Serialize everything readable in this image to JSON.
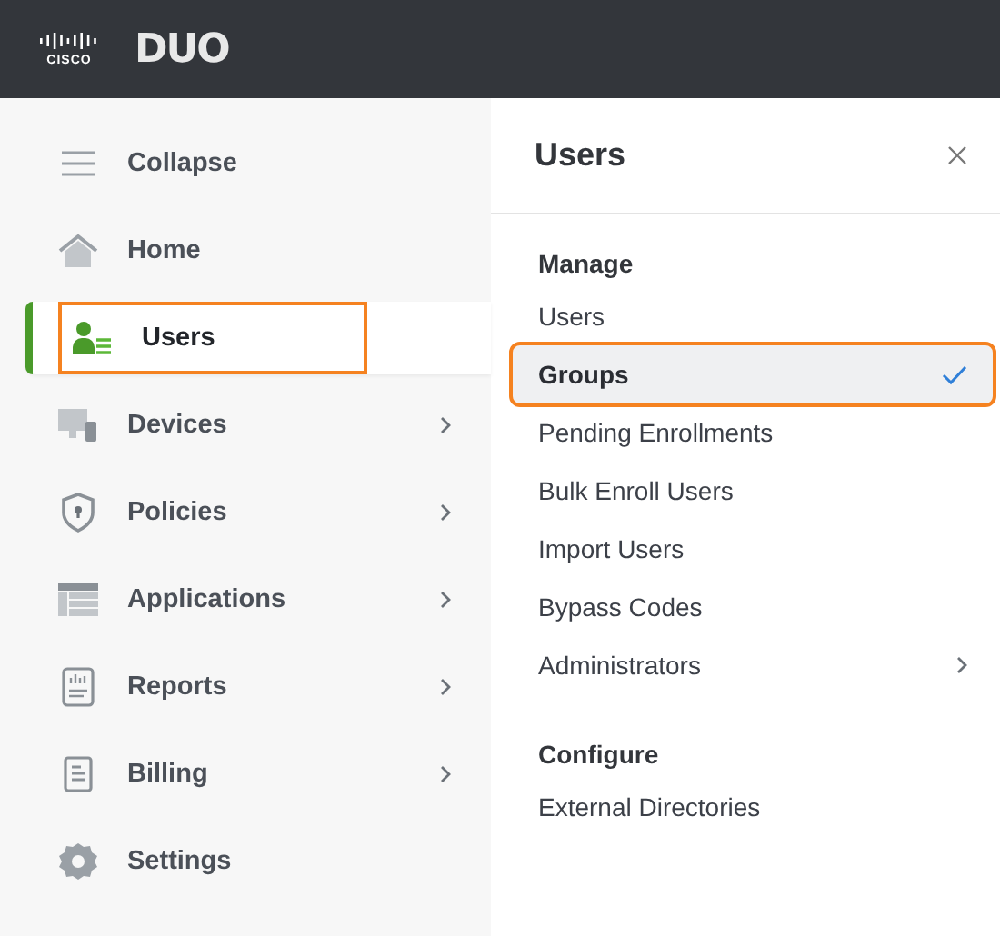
{
  "header": {
    "logo_text": "CISCO",
    "brand": "DUO"
  },
  "sidebar": {
    "collapse": "Collapse",
    "items": [
      {
        "label": "Home",
        "submenu": false,
        "selected": false,
        "highlighted": false
      },
      {
        "label": "Users",
        "submenu": false,
        "selected": true,
        "highlighted": true
      },
      {
        "label": "Devices",
        "submenu": true,
        "selected": false,
        "highlighted": false
      },
      {
        "label": "Policies",
        "submenu": true,
        "selected": false,
        "highlighted": false
      },
      {
        "label": "Applications",
        "submenu": true,
        "selected": false,
        "highlighted": false
      },
      {
        "label": "Reports",
        "submenu": true,
        "selected": false,
        "highlighted": false
      },
      {
        "label": "Billing",
        "submenu": true,
        "selected": false,
        "highlighted": false
      },
      {
        "label": "Settings",
        "submenu": false,
        "selected": false,
        "highlighted": false
      }
    ]
  },
  "panel": {
    "title": "Users",
    "sections": [
      {
        "heading": "Manage",
        "items": [
          {
            "label": "Users",
            "selected": false,
            "highlighted": false,
            "submenu": false
          },
          {
            "label": "Groups",
            "selected": true,
            "highlighted": true,
            "submenu": false
          },
          {
            "label": "Pending Enrollments",
            "selected": false,
            "highlighted": false,
            "submenu": false
          },
          {
            "label": "Bulk Enroll Users",
            "selected": false,
            "highlighted": false,
            "submenu": false
          },
          {
            "label": "Import Users",
            "selected": false,
            "highlighted": false,
            "submenu": false
          },
          {
            "label": "Bypass Codes",
            "selected": false,
            "highlighted": false,
            "submenu": false
          },
          {
            "label": "Administrators",
            "selected": false,
            "highlighted": false,
            "submenu": true
          }
        ]
      },
      {
        "heading": "Configure",
        "items": [
          {
            "label": "External Directories",
            "selected": false,
            "highlighted": false,
            "submenu": false
          }
        ]
      }
    ]
  }
}
